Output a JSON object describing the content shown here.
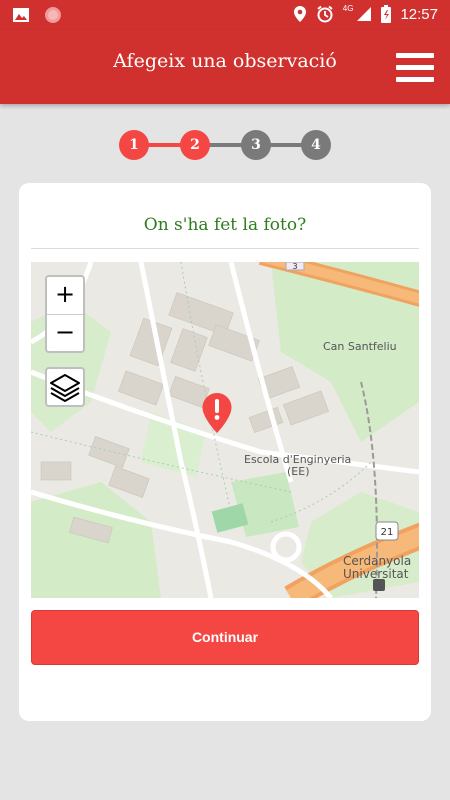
{
  "status_bar": {
    "time": "12:57",
    "network": "4G",
    "icons": [
      "gallery-icon",
      "circle-icon",
      "location-icon",
      "alarm-icon",
      "signal-icon",
      "battery-icon"
    ]
  },
  "app_bar": {
    "title": "Afegeix una observació",
    "menu_icon": "hamburger-icon"
  },
  "stepper": {
    "steps": [
      "1",
      "2",
      "3",
      "4"
    ],
    "active_color": "#f44744",
    "inactive_color": "#7a7a7a",
    "current_step": 2
  },
  "card": {
    "question": "On s'ha fet la foto?",
    "map": {
      "zoom_in": "+",
      "zoom_out": "−",
      "labels": {
        "can_santfeliu": "Can Santfeliu",
        "escola_line1": "Escola d'Enginyeria",
        "escola_line2": "(EE)",
        "cerdanyola_line1": "Cerdanyola",
        "cerdanyola_line2": "Universitat",
        "road_number": "21",
        "road_number_top": "3"
      },
      "layers_icon": "layers-icon",
      "marker_icon": "location-alert-icon"
    },
    "continue_label": "Continuar"
  },
  "colors": {
    "brand": "#d0312f",
    "accent": "#f44744",
    "question_text": "#2e7d1d"
  }
}
